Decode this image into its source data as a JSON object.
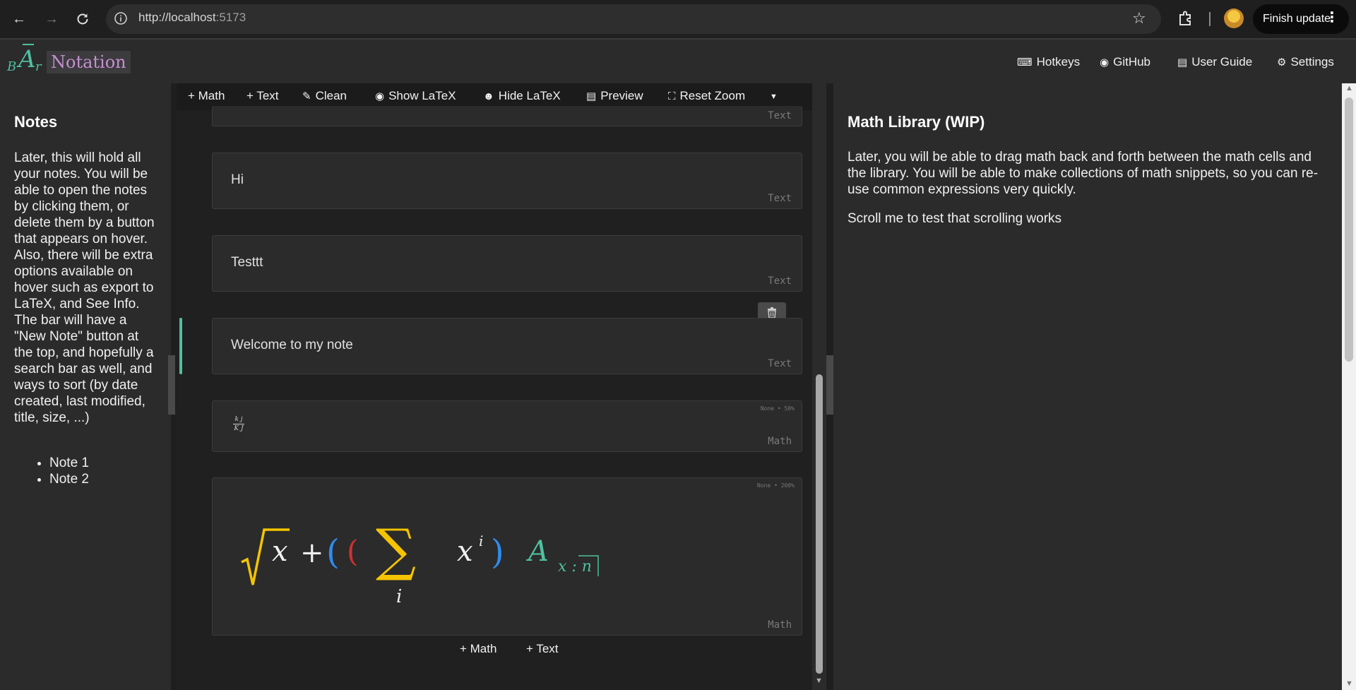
{
  "browser": {
    "url_host": "http://localhost",
    "url_port": ":5173",
    "finish_update": "Finish update"
  },
  "app": {
    "logo_b": "B",
    "logo_a": "A",
    "logo_r": "r",
    "logo_word": "Notation",
    "nav": {
      "hotkeys": "Hotkeys",
      "github": "GitHub",
      "guide": "User Guide",
      "settings": "Settings"
    }
  },
  "notes": {
    "title": "Notes",
    "body": "Later, this will hold all your notes. You will be able to open the notes by clicking them, or delete them by a button that appears on hover. Also, there will be extra options available on hover such as export to LaTeX, and See Info. The bar will have a \"New Note\" button at the top, and hopefully a search bar as well, and ways to sort (by date created, last modified, title, size, ...)",
    "items": [
      "Note 1",
      "Note 2"
    ]
  },
  "toolbar": {
    "add_math": "+ Math",
    "add_text": "+ Text",
    "clean": "Clean",
    "show_latex": "Show LaTeX",
    "hide_latex": "Hide LaTeX",
    "preview": "Preview",
    "reset_zoom": "Reset Zoom"
  },
  "cells": [
    {
      "text": "",
      "type": "Text"
    },
    {
      "text": "Hi",
      "type": "Text"
    },
    {
      "text": "Testtt",
      "type": "Text"
    },
    {
      "text": "Welcome to my note",
      "type": "Text"
    },
    {
      "type": "Math",
      "meta": "None • 50%",
      "frac_num": "k j",
      "frac_den": "K J"
    },
    {
      "type": "Math",
      "meta": "None • 200%"
    }
  ],
  "math_expr": {
    "radicand": "x",
    "plus": "+",
    "lparen": "(",
    "lparen2": "(",
    "sum": "∑",
    "sum_index": "i",
    "x": "x",
    "sup": "i",
    "rparen": ")",
    "A": "A",
    "sub": "x : n"
  },
  "bottom": {
    "add_math": "+ Math",
    "add_text": "+ Text"
  },
  "library": {
    "title": "Math Library (WIP)",
    "body": "Later, you will be able to drag math back and forth between the math cells and the library. You will be able to make collections of math snippets, so you can re-use common expressions very quickly.",
    "scroll_test": "Scroll me to test that scrolling works"
  },
  "colors": {
    "accent": "#4fc0a0",
    "logo_word": "#c58fd0",
    "math_yellow": "#f5c400",
    "math_blue": "#2f8cf0",
    "math_red": "#d23030"
  }
}
